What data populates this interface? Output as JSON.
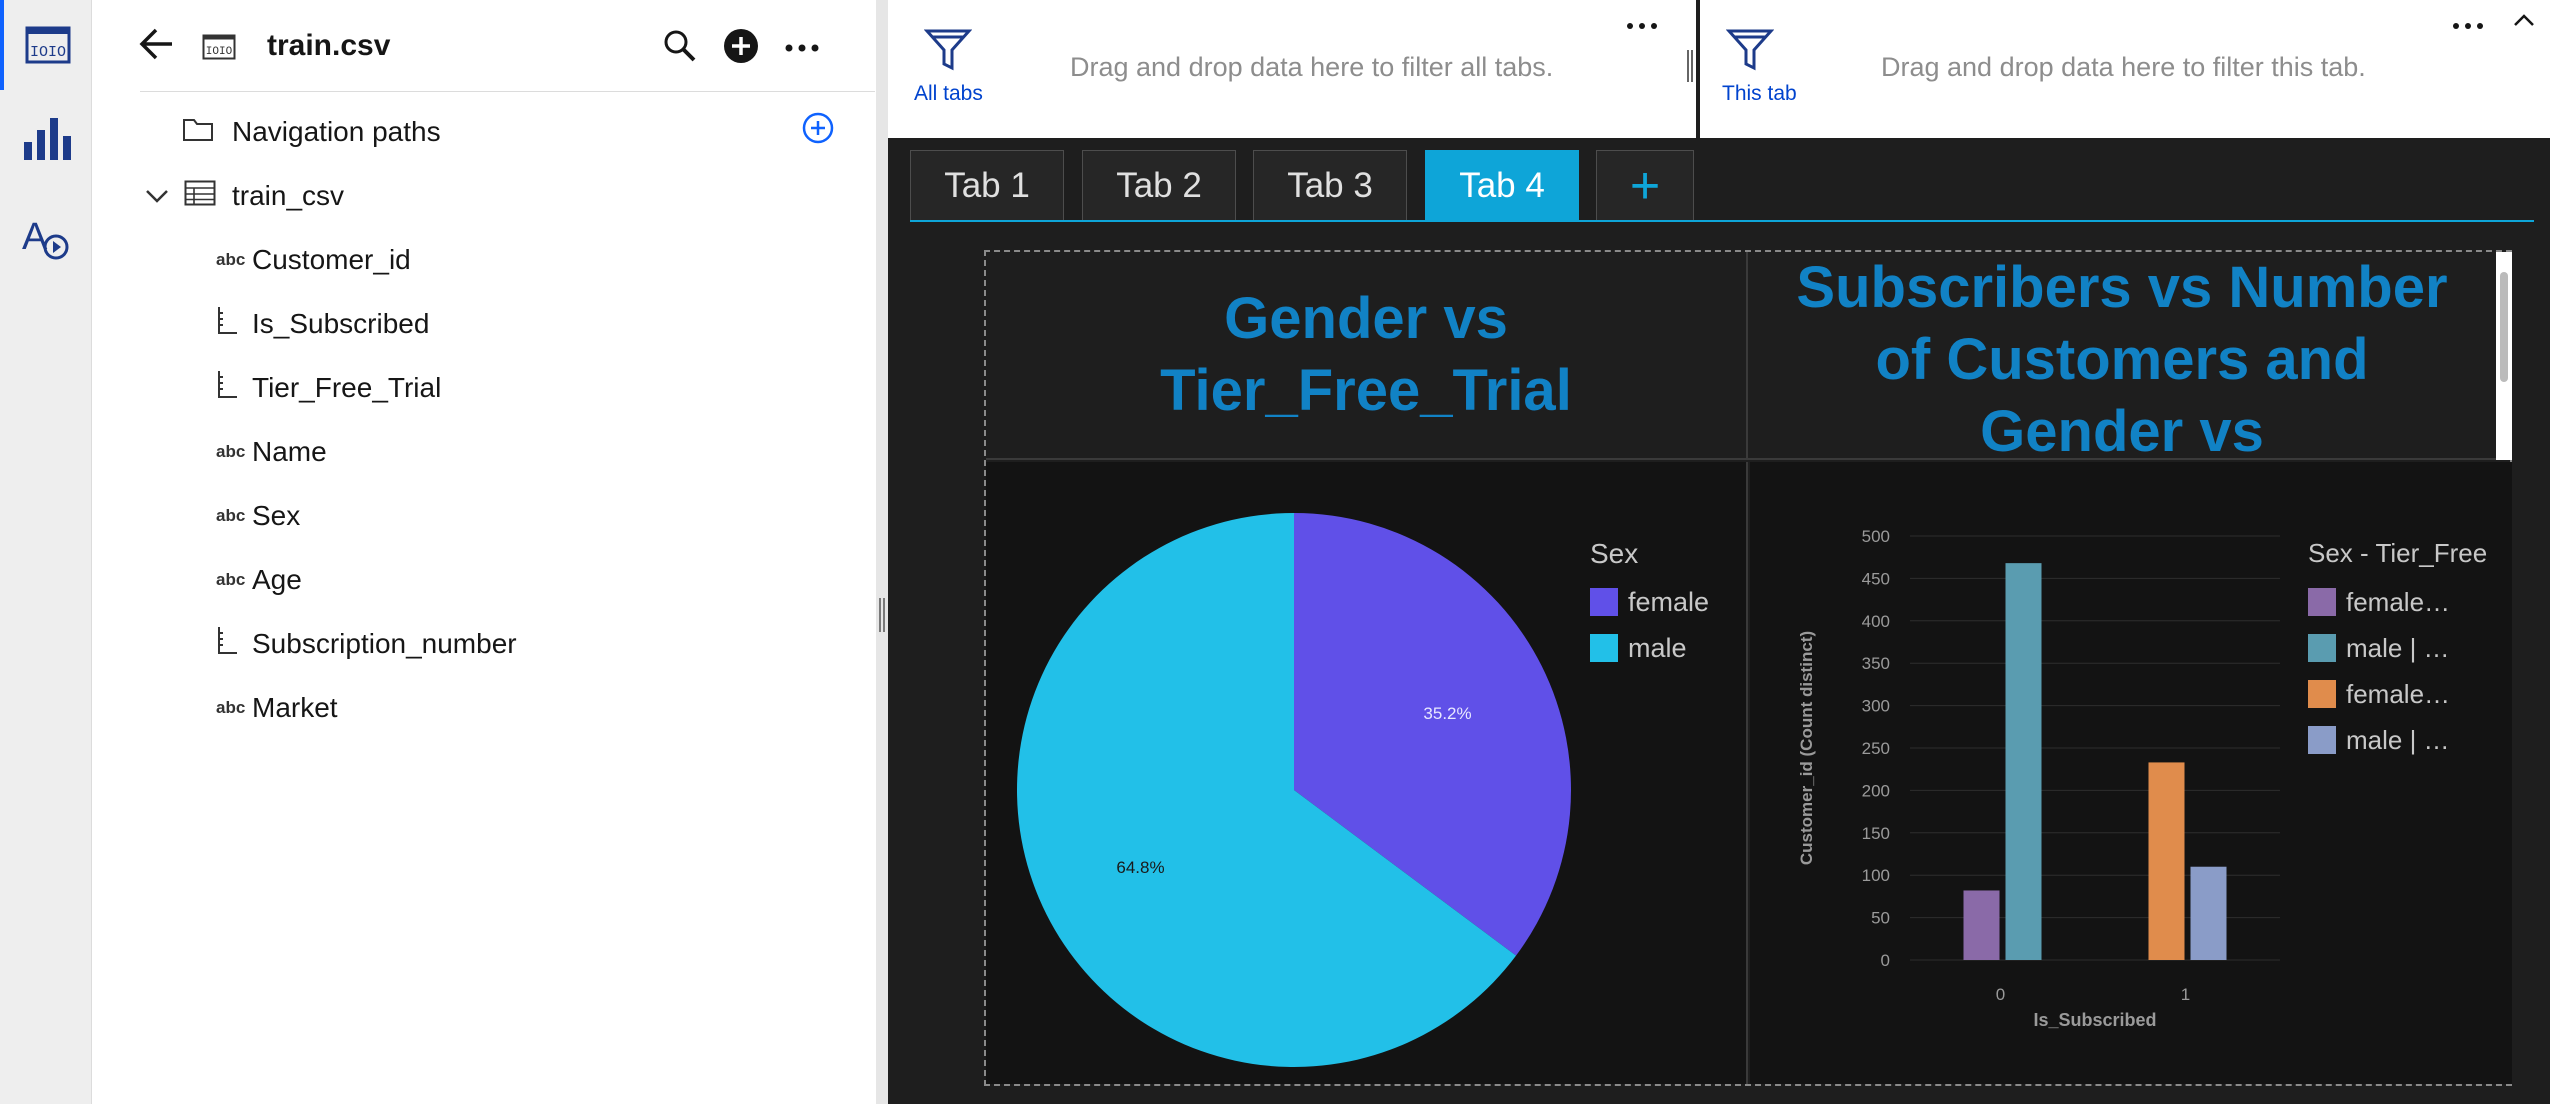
{
  "panel": {
    "file_name": "train.csv",
    "navigation_paths": "Navigation paths",
    "table_name": "train_csv",
    "columns": [
      {
        "type": "abc",
        "name": "Customer_id"
      },
      {
        "type": "measure",
        "name": "Is_Subscribed"
      },
      {
        "type": "measure",
        "name": "Tier_Free_Trial"
      },
      {
        "type": "abc",
        "name": "Name"
      },
      {
        "type": "abc",
        "name": "Sex"
      },
      {
        "type": "abc",
        "name": "Age"
      },
      {
        "type": "measure",
        "name": "Subscription_number"
      },
      {
        "type": "abc",
        "name": "Market"
      }
    ]
  },
  "filters": {
    "all_label": "All tabs",
    "all_text": "Drag and drop data here to filter all tabs.",
    "this_label": "This tab",
    "this_text": "Drag and drop data here to filter this tab."
  },
  "tabs": [
    {
      "label": "Tab 1",
      "active": false
    },
    {
      "label": "Tab 2",
      "active": false
    },
    {
      "label": "Tab 3",
      "active": false
    },
    {
      "label": "Tab 4",
      "active": true
    }
  ],
  "add_tab_glyph": "+",
  "titles": {
    "left": "Gender vs Tier_Free_Trial",
    "right": "Subscribers vs Number of Customers and Gender vs"
  },
  "chart_data": [
    {
      "type": "pie",
      "legend_title": "Sex",
      "categories": [
        "female",
        "male"
      ],
      "values": [
        35.2,
        64.8
      ],
      "labels": [
        "35.2%",
        "64.8%"
      ],
      "colors": [
        "#6050e8",
        "#22c0e8"
      ]
    },
    {
      "type": "bar",
      "xlabel": "Is_Subscribed",
      "ylabel": "Customer_id (Count distinct)",
      "categories": [
        "0",
        "1"
      ],
      "ylim": [
        0,
        500
      ],
      "yticks": [
        0,
        50,
        100,
        150,
        200,
        250,
        300,
        350,
        400,
        450,
        500
      ],
      "legend_title": "Sex - Tier_Free",
      "series": [
        {
          "name": "female…",
          "values": [
            82,
            0
          ],
          "color": "#8a6aa8"
        },
        {
          "name": "male | …",
          "values": [
            468,
            0
          ],
          "color": "#5a9cb0"
        },
        {
          "name": "female…",
          "values": [
            0,
            233
          ],
          "color": "#e08c4c"
        },
        {
          "name": "male | …",
          "values": [
            0,
            110
          ],
          "color": "#8a9cc8"
        }
      ]
    }
  ]
}
